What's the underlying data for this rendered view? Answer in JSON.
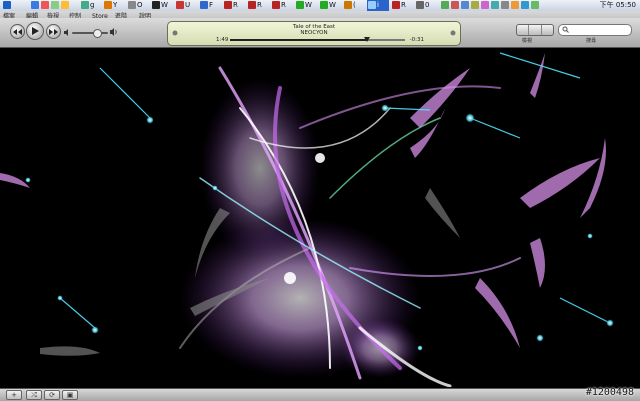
{
  "taskbar": {
    "items": [
      {
        "label": "",
        "icon": "windows-logo-icon"
      },
      {
        "label": "",
        "icon": "quicklaunch-icon"
      },
      {
        "label": "g",
        "icon": "browser-icon"
      },
      {
        "label": "Y",
        "icon": "browser-icon"
      },
      {
        "label": "O",
        "icon": "browser-icon"
      },
      {
        "label": "W",
        "icon": "user-icon"
      },
      {
        "label": "U",
        "icon": "browser-icon"
      },
      {
        "label": "F",
        "icon": "folder-icon"
      },
      {
        "label": "R",
        "icon": "rss-icon"
      },
      {
        "label": "R",
        "icon": "rss-icon"
      },
      {
        "label": "R",
        "icon": "rss-icon"
      },
      {
        "label": "W",
        "icon": "browser-icon"
      },
      {
        "label": "W",
        "icon": "browser-icon"
      },
      {
        "label": "(",
        "icon": "browser-icon"
      },
      {
        "label": "i",
        "icon": "itunes-icon"
      },
      {
        "label": "R",
        "icon": "rss-icon"
      },
      {
        "label": "0",
        "icon": "window-icon"
      }
    ],
    "clock": "下午 05:50"
  },
  "menu": [
    "檔案",
    "編輯",
    "檢視",
    "控制",
    "Store",
    "進階",
    "說明"
  ],
  "player": {
    "title": "Tale of the East",
    "artist": "NEOCYON",
    "elapsed": "1:49",
    "remaining": "-0:31",
    "progress": 0.78,
    "volume": 0.7,
    "view_label": "檢視",
    "search_label": "搜尋",
    "app_name": "iTunes"
  },
  "bottom": {
    "buttons": [
      "+",
      "⤮",
      "⟳",
      "▣"
    ]
  },
  "watermark": "#1200498",
  "colors": {
    "lcd": "#e6ebc3",
    "viz_bg": "#000000",
    "streak_pink": "#d58fe6",
    "streak_cyan": "#3fe0ff",
    "streak_green": "#6fe08a"
  }
}
